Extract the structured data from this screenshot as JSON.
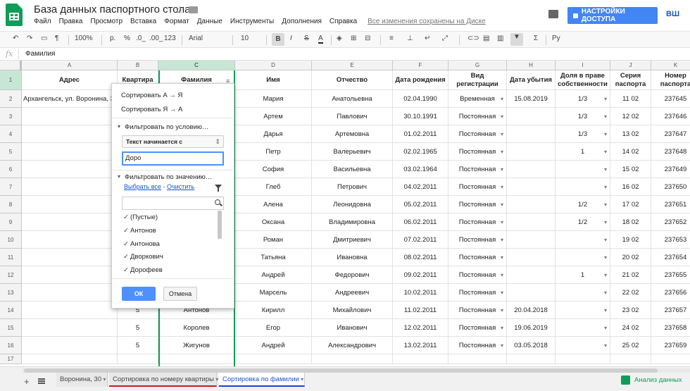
{
  "header": {
    "title": "База данных паспортного стола.",
    "menu": [
      "Файл",
      "Правка",
      "Просмотр",
      "Вставка",
      "Формат",
      "Данные",
      "Инструменты",
      "Дополнения",
      "Справка"
    ],
    "save_status": "Все изменения сохранены на Диске",
    "share_label": "НАСТРОЙКИ ДОСТУПА",
    "account": "ВШ"
  },
  "toolbar": {
    "zoom": "100%",
    "currency": "р.",
    "percent": "%",
    "dec_less": ".0_",
    "dec_more": ".00_",
    "format_more": "123",
    "font": "Arial",
    "font_size": "10",
    "bold": "B",
    "italic": "I",
    "strike": "S",
    "text_color": "A",
    "sigma": "Σ",
    "input_tools": "Ру"
  },
  "formula_bar": {
    "fx": "fx",
    "value": "Фамилия"
  },
  "columns": [
    "A",
    "B",
    "C",
    "D",
    "E",
    "F",
    "G",
    "H",
    "I",
    "J",
    "K"
  ],
  "rows": [
    "1",
    "2",
    "3",
    "4",
    "5",
    "6",
    "7",
    "8",
    "9",
    "10",
    "11",
    "12",
    "13",
    "14",
    "15",
    "16",
    "17"
  ],
  "table": {
    "headers": [
      "Адрес",
      "Квартира",
      "Фамилия",
      "Имя",
      "Отчество",
      "Дата рождения",
      "Вид регистрации",
      "Дата убытия",
      "Доля в праве собственности",
      "Серия паспорта",
      "Номер паспорта"
    ],
    "data": [
      [
        "Архангельск, ул. Воронина, 30",
        "",
        "",
        "Мария",
        "Анатольевна",
        "02.04.1990",
        "Временная",
        "15.08.2019",
        "1/3",
        "11 02",
        "237645"
      ],
      [
        "",
        "",
        "",
        "Артем",
        "Павлович",
        "30.10.1991",
        "Постоянная",
        "",
        "1/3",
        "12 02",
        "237646"
      ],
      [
        "",
        "",
        "",
        "Дарья",
        "Артемовна",
        "01.02.2011",
        "Постоянная",
        "",
        "1/3",
        "13 02",
        "237647"
      ],
      [
        "",
        "",
        "",
        "Петр",
        "Валерьевич",
        "02.02.1965",
        "Постоянная",
        "",
        "1",
        "14 02",
        "237648"
      ],
      [
        "",
        "",
        "",
        "София",
        "Васильевна",
        "03.02.1964",
        "Постоянная",
        "",
        "",
        "15 02",
        "237649"
      ],
      [
        "",
        "",
        "",
        "Глеб",
        "Петрович",
        "04.02.2011",
        "Постоянная",
        "",
        "",
        "16 02",
        "237650"
      ],
      [
        "",
        "",
        "",
        "Алена",
        "Леонидовна",
        "05.02.2011",
        "Постоянная",
        "",
        "1/2",
        "17 02",
        "237651"
      ],
      [
        "",
        "",
        "",
        "Оксана",
        "Владимировна",
        "06.02.2011",
        "Постоянная",
        "",
        "1/2",
        "18 02",
        "237652"
      ],
      [
        "",
        "",
        "",
        "Роман",
        "Дмитриевич",
        "07.02.2011",
        "Постоянная",
        "",
        "",
        "19 02",
        "237653"
      ],
      [
        "",
        "",
        "",
        "Татьяна",
        "Ивановна",
        "08.02.2011",
        "Постоянная",
        "",
        "",
        "20 02",
        "237654"
      ],
      [
        "",
        "",
        "",
        "Андрей",
        "Федорович",
        "09.02.2011",
        "Постоянная",
        "",
        "1",
        "21 02",
        "237655"
      ],
      [
        "",
        "",
        "",
        "Марсель",
        "Андреевич",
        "10.02.2011",
        "Постоянная",
        "",
        "",
        "22 02",
        "237656"
      ],
      [
        "",
        "5",
        "Антонов",
        "Кирилл",
        "Михайлович",
        "11.02.2011",
        "Постоянная",
        "20.04.2018",
        "",
        "23 02",
        "237657"
      ],
      [
        "",
        "5",
        "Королев",
        "Егор",
        "Иванович",
        "12.02.2011",
        "Постоянная",
        "19.06.2019",
        "",
        "24 02",
        "237658"
      ],
      [
        "",
        "5",
        "Жигунов",
        "Андрей",
        "Александрович",
        "13.02.2011",
        "Постоянная",
        "03.05.2018",
        "",
        "25 02",
        "237659"
      ],
      [
        "",
        "",
        "",
        "",
        "",
        "",
        "",
        "",
        "",
        "",
        ""
      ]
    ]
  },
  "filter_popup": {
    "sort_asc": "Сортировать А → Я",
    "sort_desc": "Сортировать Я → А",
    "by_condition": "Фильтровать по условию…",
    "condition": "Текст начинается с",
    "condition_value": "Доро",
    "by_values": "Фильтровать по значению…",
    "select_all": "Выбрать все",
    "link_sep": " - ",
    "clear": "Очистить",
    "values": [
      "(Пустые)",
      "Антонов",
      "Антонова",
      "Дворкович",
      "Дорофеев"
    ],
    "ok": "ОК",
    "cancel": "Отмена"
  },
  "sheets": [
    "Воронина, 30",
    "Сортировка по номеру квартиры",
    "Сортировка по фамилии"
  ],
  "explore": "Анализ данных",
  "colors": {
    "accent": "#4285f4",
    "green": "#0f9d58",
    "red_underline": "#d01818",
    "blue_underline": "#1a3ee0"
  }
}
